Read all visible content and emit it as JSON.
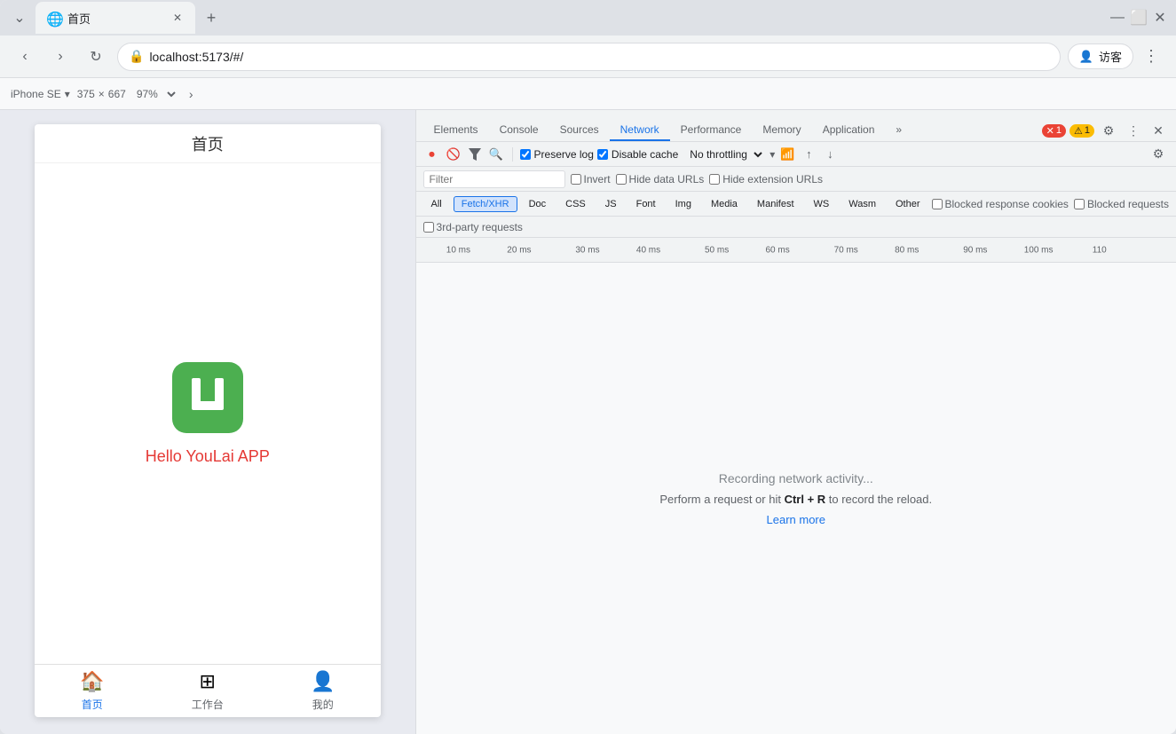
{
  "browser": {
    "tab_title": "首页",
    "tab_favicon": "🌐",
    "address": "localhost:5173/#/",
    "visitor_label": "访客",
    "win_minimize": "—",
    "win_maximize": "⬜",
    "win_close": "✕"
  },
  "device_toolbar": {
    "device_name": "iPhone SE",
    "width": "375",
    "height_sep": "×",
    "height": "667",
    "zoom": "97%",
    "more_icon": "›"
  },
  "phone": {
    "page_title": "首页",
    "app_name": "Hello YouLai APP",
    "logo_letter": "U",
    "nav": [
      {
        "label": "首页",
        "icon": "⌂",
        "active": true
      },
      {
        "label": "工作台",
        "icon": "⊞",
        "active": false
      },
      {
        "label": "我的",
        "icon": "☻",
        "active": false
      }
    ]
  },
  "devtools": {
    "tabs": [
      {
        "label": "Elements",
        "active": false
      },
      {
        "label": "Console",
        "active": false
      },
      {
        "label": "Sources",
        "active": false
      },
      {
        "label": "Network",
        "active": true
      },
      {
        "label": "Performance",
        "active": false
      },
      {
        "label": "Memory",
        "active": false
      },
      {
        "label": "Application",
        "active": false
      }
    ],
    "error_count": "1",
    "warn_count": "1",
    "toolbar": {
      "preserve_log": "Preserve log",
      "disable_cache": "Disable cache",
      "no_throttling": "No throttling"
    },
    "filter_placeholder": "Filter",
    "invert_label": "Invert",
    "hide_data_urls": "Hide data URLs",
    "hide_ext_urls": "Hide extension URLs",
    "type_filters": [
      "All",
      "Fetch/XHR",
      "Doc",
      "CSS",
      "JS",
      "Font",
      "Img",
      "Media",
      "Manifest",
      "WS",
      "Wasm",
      "Other"
    ],
    "active_type_filter": "Fetch/XHR",
    "blocked_response_cookies": "Blocked response cookies",
    "blocked_requests": "Blocked requests",
    "third_party": "3rd-party requests",
    "timeline": {
      "labels": [
        "10 ms",
        "20 ms",
        "30 ms",
        "40 ms",
        "50 ms",
        "60 ms",
        "70 ms",
        "80 ms",
        "90 ms",
        "100 ms",
        "110"
      ]
    },
    "empty_state": {
      "title": "Recording network activity...",
      "desc_start": "Perform a request or hit ",
      "shortcut": "Ctrl + R",
      "desc_end": " to record the reload.",
      "learn_more": "Learn more"
    }
  }
}
